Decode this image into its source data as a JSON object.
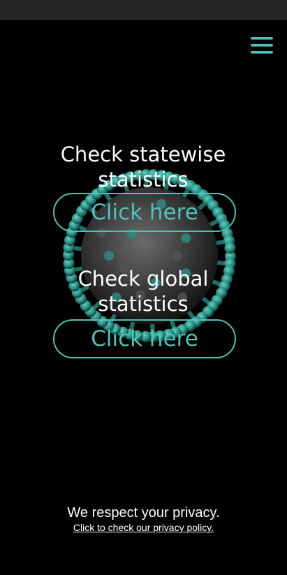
{
  "menu": {
    "icon": "hamburger-menu-icon",
    "color": "#4ec3b5"
  },
  "background": {
    "image": "coronavirus-illustration",
    "accent_color": "#3aa89b"
  },
  "statewise": {
    "title": "Check statewise statistics",
    "button_label": "Click here"
  },
  "global": {
    "title": "Check global statistics",
    "button_label": "Click here"
  },
  "footer": {
    "privacy_text": "We respect your privacy.",
    "privacy_link": "Click to check our privacy policy."
  },
  "colors": {
    "background": "#000000",
    "status_bar": "#262626",
    "accent": "#4ec3b5",
    "text": "#ffffff"
  }
}
